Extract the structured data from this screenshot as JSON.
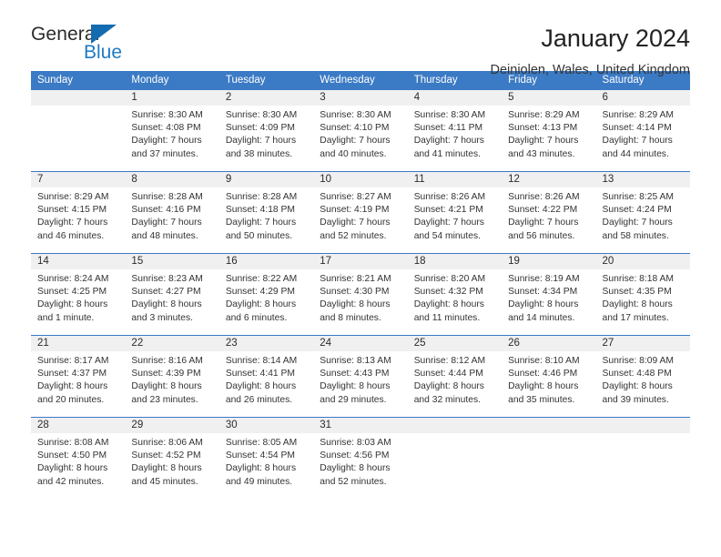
{
  "brand": {
    "word1": "General",
    "word2": "Blue",
    "triangle_color": "#156bb0",
    "blue_color": "#1f7ac4"
  },
  "header": {
    "title": "January 2024",
    "subtitle": "Deiniolen, Wales, United Kingdom",
    "header_bg": "#3b7ac4",
    "daynum_bg": "#f0f0f0"
  },
  "weekday_headers": [
    "Sunday",
    "Monday",
    "Tuesday",
    "Wednesday",
    "Thursday",
    "Friday",
    "Saturday"
  ],
  "labels": {
    "sunrise_prefix": "Sunrise:",
    "sunset_prefix": "Sunset:",
    "daylight_prefix": "Daylight:"
  },
  "weeks": [
    [
      {
        "day": "",
        "empty": true,
        "line1": "",
        "line2": "",
        "line3": "",
        "line4": ""
      },
      {
        "day": "1",
        "empty": false,
        "line1": "Sunrise: 8:30 AM",
        "line2": "Sunset: 4:08 PM",
        "line3": "Daylight: 7 hours",
        "line4": "and 37 minutes."
      },
      {
        "day": "2",
        "empty": false,
        "line1": "Sunrise: 8:30 AM",
        "line2": "Sunset: 4:09 PM",
        "line3": "Daylight: 7 hours",
        "line4": "and 38 minutes."
      },
      {
        "day": "3",
        "empty": false,
        "line1": "Sunrise: 8:30 AM",
        "line2": "Sunset: 4:10 PM",
        "line3": "Daylight: 7 hours",
        "line4": "and 40 minutes."
      },
      {
        "day": "4",
        "empty": false,
        "line1": "Sunrise: 8:30 AM",
        "line2": "Sunset: 4:11 PM",
        "line3": "Daylight: 7 hours",
        "line4": "and 41 minutes."
      },
      {
        "day": "5",
        "empty": false,
        "line1": "Sunrise: 8:29 AM",
        "line2": "Sunset: 4:13 PM",
        "line3": "Daylight: 7 hours",
        "line4": "and 43 minutes."
      },
      {
        "day": "6",
        "empty": false,
        "line1": "Sunrise: 8:29 AM",
        "line2": "Sunset: 4:14 PM",
        "line3": "Daylight: 7 hours",
        "line4": "and 44 minutes."
      }
    ],
    [
      {
        "day": "7",
        "empty": false,
        "line1": "Sunrise: 8:29 AM",
        "line2": "Sunset: 4:15 PM",
        "line3": "Daylight: 7 hours",
        "line4": "and 46 minutes."
      },
      {
        "day": "8",
        "empty": false,
        "line1": "Sunrise: 8:28 AM",
        "line2": "Sunset: 4:16 PM",
        "line3": "Daylight: 7 hours",
        "line4": "and 48 minutes."
      },
      {
        "day": "9",
        "empty": false,
        "line1": "Sunrise: 8:28 AM",
        "line2": "Sunset: 4:18 PM",
        "line3": "Daylight: 7 hours",
        "line4": "and 50 minutes."
      },
      {
        "day": "10",
        "empty": false,
        "line1": "Sunrise: 8:27 AM",
        "line2": "Sunset: 4:19 PM",
        "line3": "Daylight: 7 hours",
        "line4": "and 52 minutes."
      },
      {
        "day": "11",
        "empty": false,
        "line1": "Sunrise: 8:26 AM",
        "line2": "Sunset: 4:21 PM",
        "line3": "Daylight: 7 hours",
        "line4": "and 54 minutes."
      },
      {
        "day": "12",
        "empty": false,
        "line1": "Sunrise: 8:26 AM",
        "line2": "Sunset: 4:22 PM",
        "line3": "Daylight: 7 hours",
        "line4": "and 56 minutes."
      },
      {
        "day": "13",
        "empty": false,
        "line1": "Sunrise: 8:25 AM",
        "line2": "Sunset: 4:24 PM",
        "line3": "Daylight: 7 hours",
        "line4": "and 58 minutes."
      }
    ],
    [
      {
        "day": "14",
        "empty": false,
        "line1": "Sunrise: 8:24 AM",
        "line2": "Sunset: 4:25 PM",
        "line3": "Daylight: 8 hours",
        "line4": "and 1 minute."
      },
      {
        "day": "15",
        "empty": false,
        "line1": "Sunrise: 8:23 AM",
        "line2": "Sunset: 4:27 PM",
        "line3": "Daylight: 8 hours",
        "line4": "and 3 minutes."
      },
      {
        "day": "16",
        "empty": false,
        "line1": "Sunrise: 8:22 AM",
        "line2": "Sunset: 4:29 PM",
        "line3": "Daylight: 8 hours",
        "line4": "and 6 minutes."
      },
      {
        "day": "17",
        "empty": false,
        "line1": "Sunrise: 8:21 AM",
        "line2": "Sunset: 4:30 PM",
        "line3": "Daylight: 8 hours",
        "line4": "and 8 minutes."
      },
      {
        "day": "18",
        "empty": false,
        "line1": "Sunrise: 8:20 AM",
        "line2": "Sunset: 4:32 PM",
        "line3": "Daylight: 8 hours",
        "line4": "and 11 minutes."
      },
      {
        "day": "19",
        "empty": false,
        "line1": "Sunrise: 8:19 AM",
        "line2": "Sunset: 4:34 PM",
        "line3": "Daylight: 8 hours",
        "line4": "and 14 minutes."
      },
      {
        "day": "20",
        "empty": false,
        "line1": "Sunrise: 8:18 AM",
        "line2": "Sunset: 4:35 PM",
        "line3": "Daylight: 8 hours",
        "line4": "and 17 minutes."
      }
    ],
    [
      {
        "day": "21",
        "empty": false,
        "line1": "Sunrise: 8:17 AM",
        "line2": "Sunset: 4:37 PM",
        "line3": "Daylight: 8 hours",
        "line4": "and 20 minutes."
      },
      {
        "day": "22",
        "empty": false,
        "line1": "Sunrise: 8:16 AM",
        "line2": "Sunset: 4:39 PM",
        "line3": "Daylight: 8 hours",
        "line4": "and 23 minutes."
      },
      {
        "day": "23",
        "empty": false,
        "line1": "Sunrise: 8:14 AM",
        "line2": "Sunset: 4:41 PM",
        "line3": "Daylight: 8 hours",
        "line4": "and 26 minutes."
      },
      {
        "day": "24",
        "empty": false,
        "line1": "Sunrise: 8:13 AM",
        "line2": "Sunset: 4:43 PM",
        "line3": "Daylight: 8 hours",
        "line4": "and 29 minutes."
      },
      {
        "day": "25",
        "empty": false,
        "line1": "Sunrise: 8:12 AM",
        "line2": "Sunset: 4:44 PM",
        "line3": "Daylight: 8 hours",
        "line4": "and 32 minutes."
      },
      {
        "day": "26",
        "empty": false,
        "line1": "Sunrise: 8:10 AM",
        "line2": "Sunset: 4:46 PM",
        "line3": "Daylight: 8 hours",
        "line4": "and 35 minutes."
      },
      {
        "day": "27",
        "empty": false,
        "line1": "Sunrise: 8:09 AM",
        "line2": "Sunset: 4:48 PM",
        "line3": "Daylight: 8 hours",
        "line4": "and 39 minutes."
      }
    ],
    [
      {
        "day": "28",
        "empty": false,
        "line1": "Sunrise: 8:08 AM",
        "line2": "Sunset: 4:50 PM",
        "line3": "Daylight: 8 hours",
        "line4": "and 42 minutes."
      },
      {
        "day": "29",
        "empty": false,
        "line1": "Sunrise: 8:06 AM",
        "line2": "Sunset: 4:52 PM",
        "line3": "Daylight: 8 hours",
        "line4": "and 45 minutes."
      },
      {
        "day": "30",
        "empty": false,
        "line1": "Sunrise: 8:05 AM",
        "line2": "Sunset: 4:54 PM",
        "line3": "Daylight: 8 hours",
        "line4": "and 49 minutes."
      },
      {
        "day": "31",
        "empty": false,
        "line1": "Sunrise: 8:03 AM",
        "line2": "Sunset: 4:56 PM",
        "line3": "Daylight: 8 hours",
        "line4": "and 52 minutes."
      },
      {
        "day": "",
        "empty": true,
        "line1": "",
        "line2": "",
        "line3": "",
        "line4": ""
      },
      {
        "day": "",
        "empty": true,
        "line1": "",
        "line2": "",
        "line3": "",
        "line4": ""
      },
      {
        "day": "",
        "empty": true,
        "line1": "",
        "line2": "",
        "line3": "",
        "line4": ""
      }
    ]
  ]
}
